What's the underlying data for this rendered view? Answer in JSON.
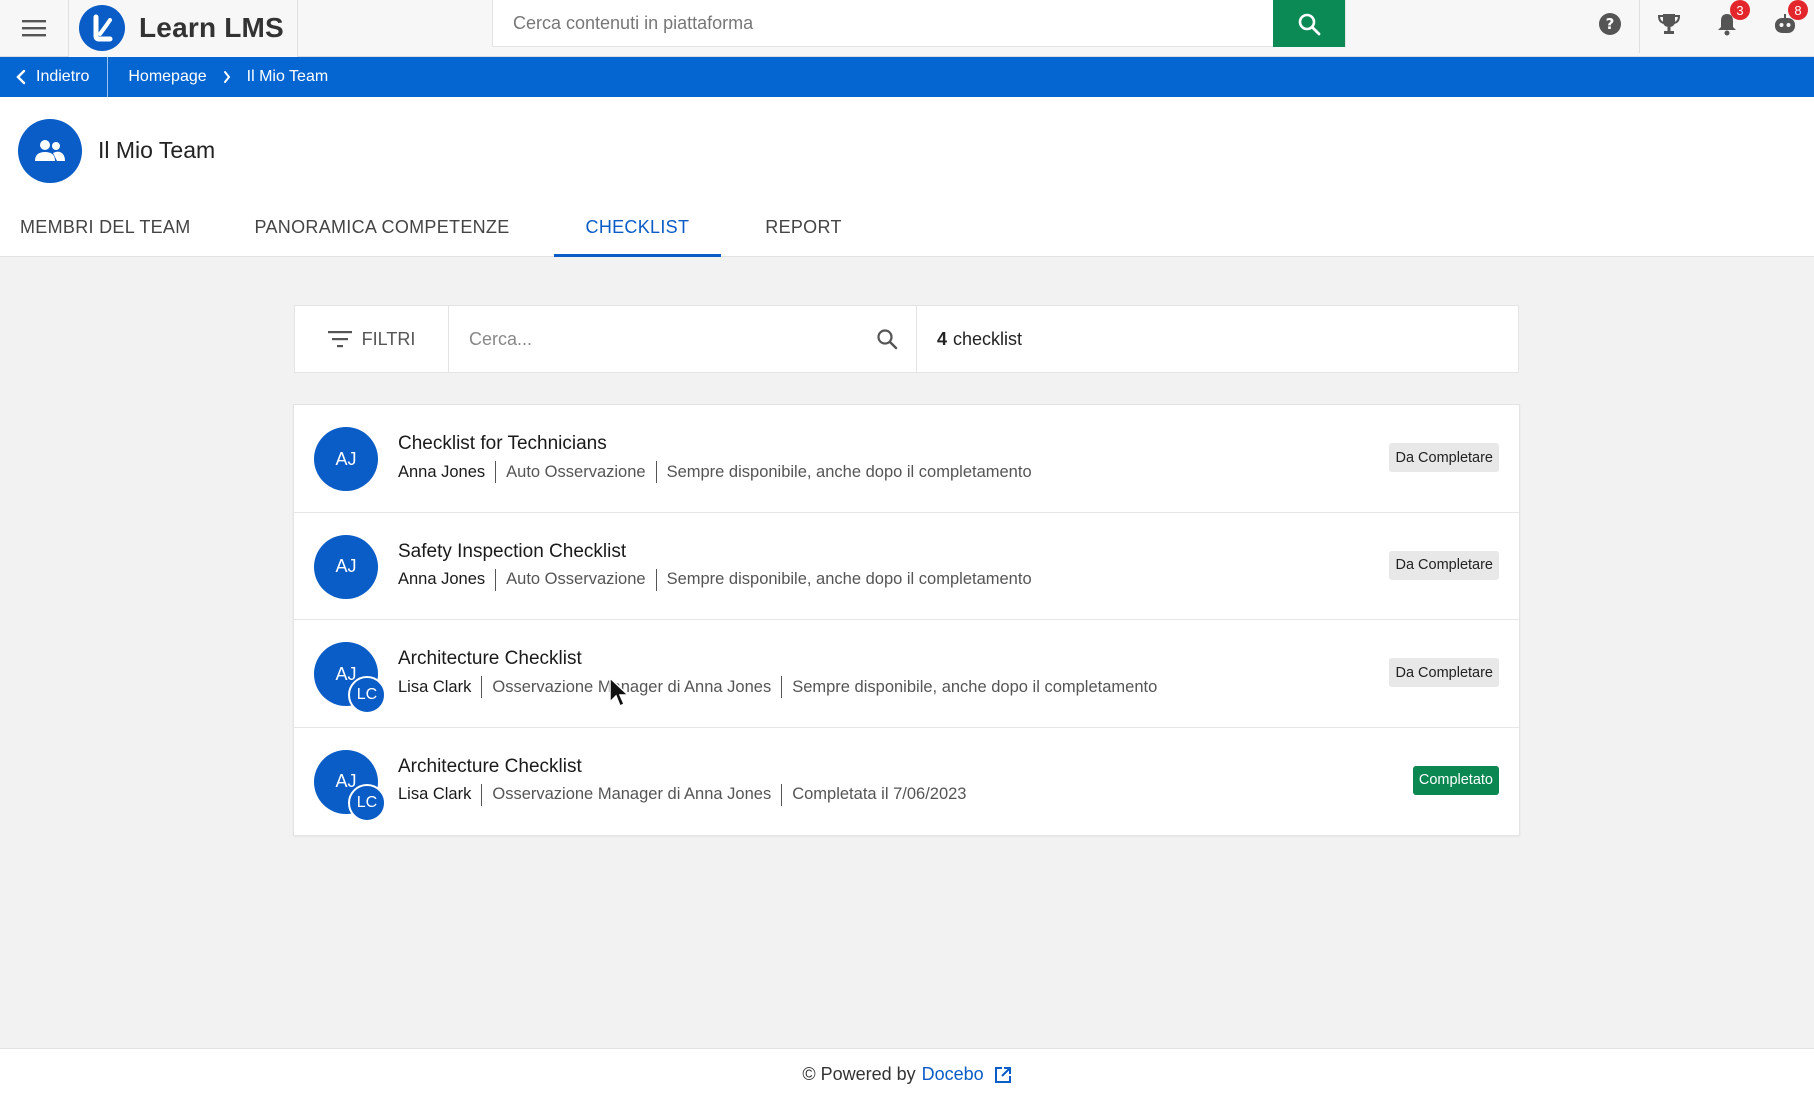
{
  "app": {
    "brand_name": "Learn LMS"
  },
  "header": {
    "search_placeholder": "Cerca contenuti in piattaforma",
    "notifications_count": "3",
    "messages_count": "8"
  },
  "breadcrumb": {
    "back_label": "Indietro",
    "items": [
      "Homepage",
      "Il Mio Team"
    ]
  },
  "page": {
    "title": "Il Mio Team",
    "tabs": [
      {
        "label": "MEMBRI DEL TEAM",
        "active": false
      },
      {
        "label": "PANORAMICA COMPETENZE",
        "active": false
      },
      {
        "label": "CHECKLIST",
        "active": true
      },
      {
        "label": "REPORT",
        "active": false
      }
    ]
  },
  "toolbar": {
    "filters_label": "FILTRI",
    "search_placeholder": "Cerca...",
    "count_number": "4",
    "count_label": "checklist"
  },
  "checklists": [
    {
      "title": "Checklist for Technicians",
      "avatar": "AJ",
      "avatar_sub": "",
      "owner": "Anna Jones",
      "type": "Auto Osservazione",
      "availability": "Sempre disponibile, anche dopo il completamento",
      "status": "Da Completare"
    },
    {
      "title": "Safety Inspection Checklist",
      "avatar": "AJ",
      "avatar_sub": "",
      "owner": "Anna Jones",
      "type": "Auto Osservazione",
      "availability": "Sempre disponibile, anche dopo il completamento",
      "status": "Da Completare"
    },
    {
      "title": "Architecture Checklist",
      "avatar": "AJ",
      "avatar_sub": "LC",
      "owner": "Lisa Clark",
      "type": "Osservazione Manager di Anna Jones",
      "availability": "Sempre disponibile, anche dopo il completamento",
      "status": "Da Completare"
    },
    {
      "title": "Architecture Checklist",
      "avatar": "AJ",
      "avatar_sub": "LC",
      "owner": "Lisa Clark",
      "type": "Osservazione Manager di Anna Jones",
      "availability": "Completata il 7/06/2023",
      "status": "Completato"
    }
  ],
  "footer": {
    "prefix": "© Powered by",
    "brand": "Docebo"
  },
  "colors": {
    "primary": "#0565d1",
    "accent_green": "#0c8a55",
    "badge_red": "#e3262c"
  }
}
